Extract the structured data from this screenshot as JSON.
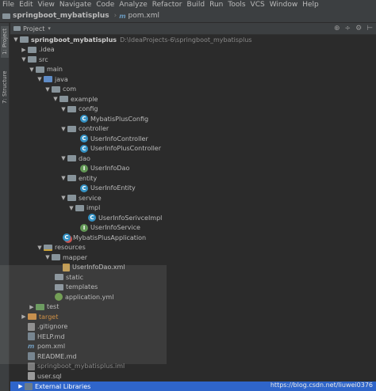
{
  "menu": [
    "File",
    "Edit",
    "View",
    "Navigate",
    "Code",
    "Analyze",
    "Refactor",
    "Build",
    "Run",
    "Tools",
    "VCS",
    "Window",
    "Help"
  ],
  "breadcrumb": {
    "project": "springboot_mybatisplus",
    "file": "pom.xml"
  },
  "side_tabs": {
    "project": "1: Project",
    "structure": "7: Structure"
  },
  "panel": {
    "title": "Project",
    "tools": [
      "⊕",
      "÷",
      "⚙",
      "⊢"
    ]
  },
  "tree": {
    "root": {
      "name": "springboot_mybatisplus",
      "path": "D:\\IdeaProjects-6\\springboot_mybatisplus"
    },
    "idea": ".idea",
    "src": "src",
    "main": "main",
    "java": "java",
    "com": "com",
    "example": "example",
    "config": "config",
    "config_class": "MybatisPlusConfig",
    "controller": "controller",
    "controller_class1": "UserInfoController",
    "controller_class2": "UserInfoPlusController",
    "dao": "dao",
    "dao_class": "UserInfoDao",
    "entity": "entity",
    "entity_class": "UserInfoEntity",
    "service": "service",
    "impl": "impl",
    "impl_class": "UserInfoSerivceImpl",
    "service_iface": "UserInfoService",
    "app_class": "MybatisPlusApplication",
    "resources": "resources",
    "mapper": "mapper",
    "mapper_xml": "UserInfoDao.xml",
    "static": "static",
    "templates": "templates",
    "app_yml": "application.yml",
    "test": "test",
    "target": "target",
    "gitignore": ".gitignore",
    "help_md": "HELP.md",
    "pom": "pom.xml",
    "readme": "README.md",
    "iml": "springboot_mybatisplus.iml",
    "user_sql": "user.sql",
    "ext_libs": "External Libraries"
  },
  "watermark": "https://blog.csdn.net/liuwei0376"
}
